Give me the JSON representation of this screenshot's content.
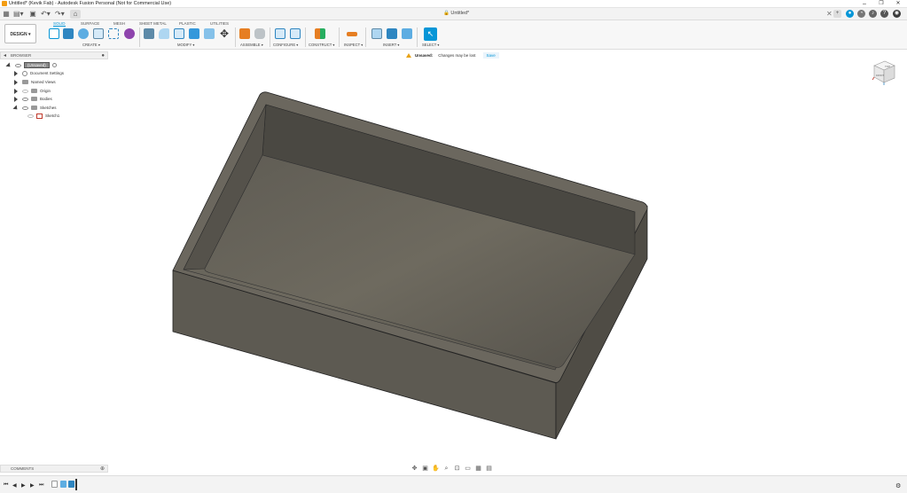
{
  "window": {
    "title": "Untitled* (Kevik Fab) - Autodesk Fusion Personal (Not for Commercial Use)",
    "controls": {
      "minimize": "–",
      "maximize": "❐",
      "close": "✕"
    }
  },
  "quick_access": {
    "document_title": "Untitled*",
    "document_close": "✕"
  },
  "ribbon": {
    "workspace_button": "DESIGN ▾",
    "tabs": [
      "SOLID",
      "SURFACE",
      "MESH",
      "SHEET METAL",
      "PLASTIC",
      "UTILITIES"
    ],
    "active_tab": "SOLID",
    "groups": [
      {
        "label": "CREATE ▾"
      },
      {
        "label": "MODIFY ▾"
      },
      {
        "label": "ASSEMBLE ▾"
      },
      {
        "label": "CONFIGURE ▾"
      },
      {
        "label": "CONSTRUCT ▾"
      },
      {
        "label": "INSPECT ▾"
      },
      {
        "label": "INSERT ▾"
      },
      {
        "label": "SELECT ▾"
      }
    ]
  },
  "browser": {
    "header": "BROWSER",
    "root_label": "(Unsaved)",
    "items": [
      {
        "label": "Document Settings"
      },
      {
        "label": "Named Views"
      },
      {
        "label": "Origin"
      },
      {
        "label": "Bodies"
      },
      {
        "label": "Sketches"
      },
      {
        "label": "Sketch1"
      }
    ]
  },
  "notification": {
    "title": "Unsaved:",
    "message": "Changes may be lost",
    "action": "Save"
  },
  "viewcube": {
    "face_top": "TOP",
    "face_front": "FRONT"
  },
  "comments": {
    "header": "COMMENTS"
  },
  "colors": {
    "accent": "#0696d7",
    "model_top": "#6b675e",
    "model_side": "#5a574f",
    "model_floor": "#676358",
    "warning": "#e8a317"
  }
}
